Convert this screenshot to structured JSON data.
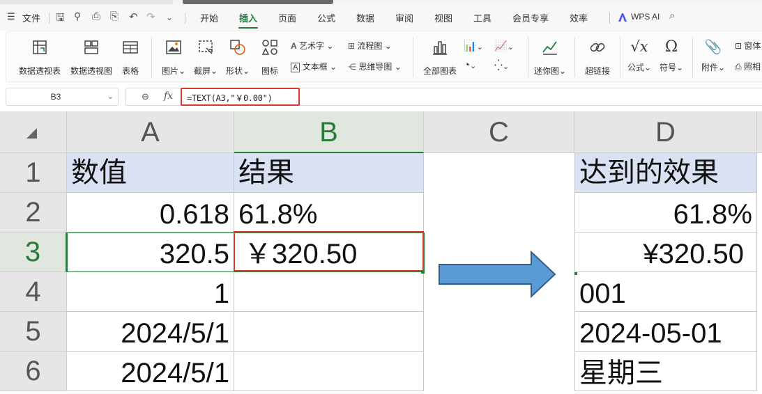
{
  "menu": {
    "file": "文件",
    "tabs": [
      "开始",
      "插入",
      "页面",
      "公式",
      "数据",
      "审阅",
      "视图",
      "工具",
      "会员专享",
      "效率"
    ],
    "active_tab": "插入",
    "wps_ai": "WPS AI",
    "accent_color": "#1f7a3e"
  },
  "ribbon": {
    "pivot_table": "数据透视表",
    "pivot_chart": "数据透视图",
    "table": "表格",
    "picture": "图片",
    "screenshot": "截屏",
    "shape": "形状",
    "icon": "图标",
    "art_text": "艺术字",
    "text_box": "文本框",
    "flowchart": "流程图",
    "mind_map": "思维导图",
    "all_charts": "全部图表",
    "sparkline": "迷你图",
    "hyperlink": "超链接",
    "formula": "公式",
    "symbol": "符号",
    "attachment": "附件",
    "window_cut": "窗体",
    "camera_cut": "照相"
  },
  "formula_bar": {
    "cell_ref": "B3",
    "formula": "=TEXT(A3,\"￥0.00\")",
    "highlight_color": "#d63a2c"
  },
  "sheet": {
    "columns": [
      "A",
      "B",
      "C",
      "D"
    ],
    "selected_column": "B",
    "rows": [
      "1",
      "2",
      "3",
      "4",
      "5",
      "6"
    ],
    "selected_row": "3",
    "a": [
      "数值",
      "0.618",
      "320.5",
      "1",
      "2024/5/1",
      "2024/5/1"
    ],
    "b": [
      "结果",
      "61.8%",
      "￥320.50",
      "",
      "",
      ""
    ],
    "d": [
      "达到的效果",
      "61.8%",
      "¥320.50",
      "001",
      "2024-05-01",
      "星期三"
    ],
    "header_fill": "#d9e1f2",
    "arrow_color": "#5b9bd5"
  }
}
